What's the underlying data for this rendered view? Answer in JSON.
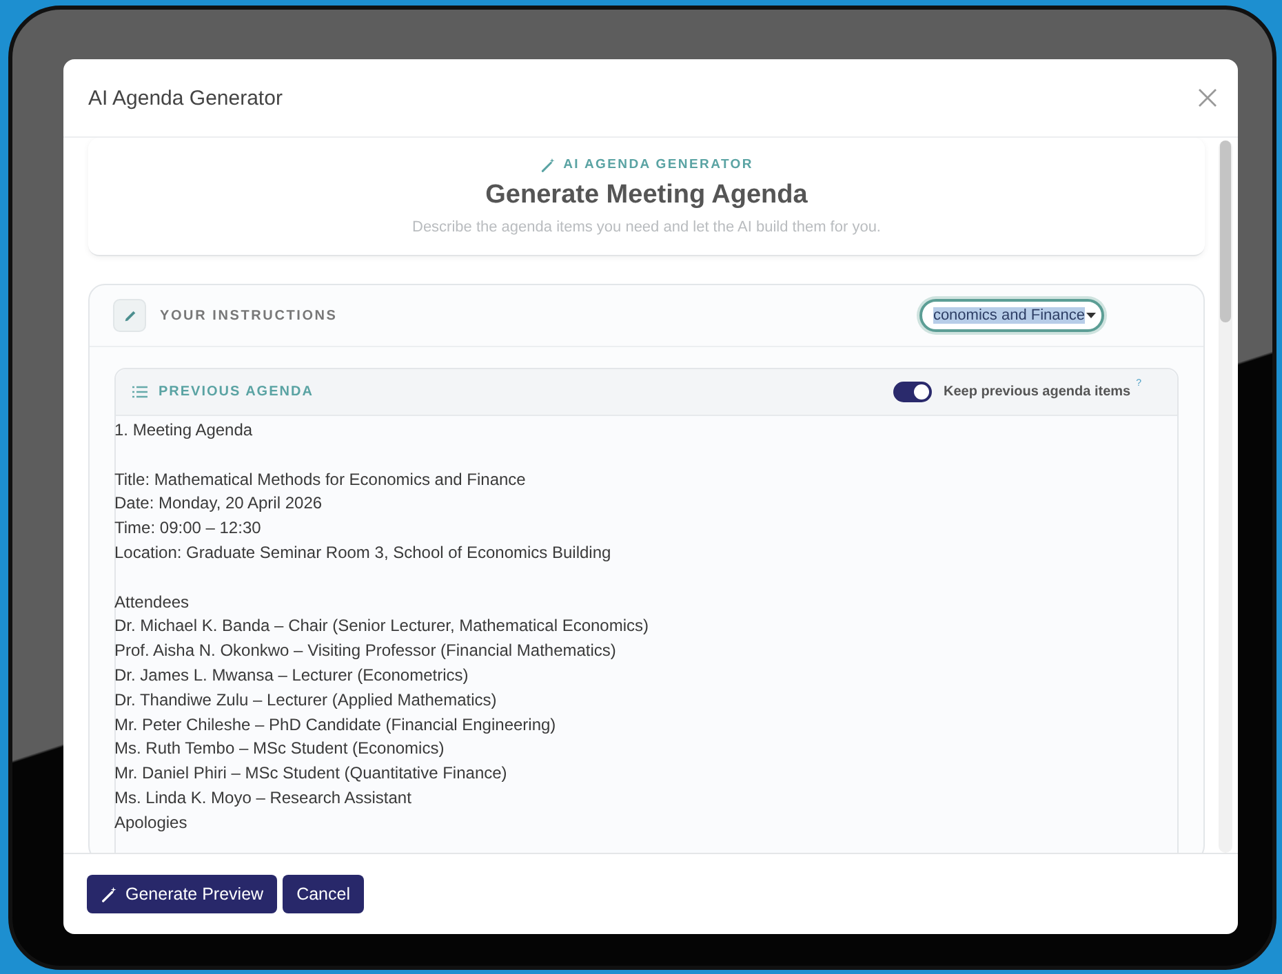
{
  "dialog": {
    "title": "AI Agenda Generator"
  },
  "intro": {
    "eyebrow": "AI AGENDA GENERATOR",
    "heading": "Generate Meeting Agenda",
    "description": "Describe the agenda items you need and let the AI build them for you."
  },
  "instructions": {
    "label": "YOUR INSTRUCTIONS",
    "field_value": "conomics and Finance"
  },
  "previous_agenda": {
    "label": "PREVIOUS AGENDA",
    "keep_previous": {
      "label": "Keep previous agenda items",
      "on": true,
      "hint": "?"
    },
    "blocks": [
      [
        "1. Meeting Agenda"
      ],
      [
        "Title: Mathematical Methods for Economics and Finance",
        "Date: Monday, 20 April 2026",
        "Time: 09:00 – 12:30",
        "Location: Graduate Seminar Room 3, School of Economics Building"
      ],
      [
        "Attendees",
        "Dr. Michael K. Banda – Chair (Senior Lecturer, Mathematical Economics)",
        "Prof. Aisha N. Okonkwo – Visiting Professor (Financial Mathematics)",
        "Dr. James L. Mwansa – Lecturer (Econometrics)",
        "Dr. Thandiwe Zulu – Lecturer (Applied Mathematics)",
        "Mr. Peter Chileshe – PhD Candidate (Financial Engineering)",
        "Ms. Ruth Tembo – MSc Student (Economics)",
        "Mr. Daniel Phiri – MSc Student (Quantitative Finance)",
        "Ms. Linda K. Moyo – Research Assistant",
        "Apologies"
      ]
    ]
  },
  "buttons": [
    {
      "label": "Generate Preview",
      "kind": "primary-icon"
    },
    {
      "label": "Cancel",
      "kind": "primary"
    }
  ]
}
